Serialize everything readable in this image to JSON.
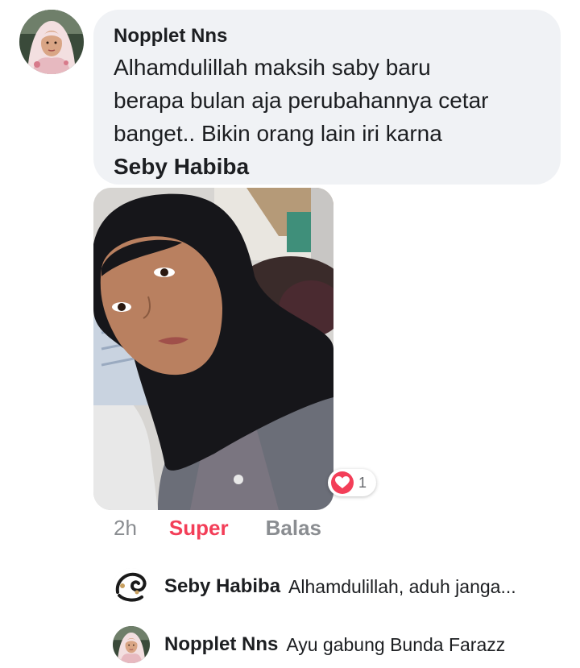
{
  "comment": {
    "author": "Nopplet Nns",
    "text_lines": [
      "Alhamdulillah maksih saby baru",
      "berapa bulan aja perubahannya cetar",
      "banget..  Bikin orang lain iri karna"
    ],
    "tag": "Seby Habiba",
    "avatar_icon": "profile-photo-icon",
    "photo_icon": "selfie-photo-icon"
  },
  "reaction": {
    "icon": "heart-icon",
    "count": "1",
    "color": "#f33e58"
  },
  "actions": {
    "time": "2h",
    "reaction_label": "Super",
    "reply_label": "Balas"
  },
  "replies": [
    {
      "name": "Seby Habiba",
      "text": "Alhamdulillah, aduh janga...",
      "avatar_icon": "logo-avatar-icon"
    },
    {
      "name": "Nopplet Nns",
      "text": "Ayu gabung Bunda Farazz",
      "avatar_icon": "profile-photo-icon"
    }
  ],
  "colors": {
    "bubble_bg": "#f0f2f5",
    "text": "#1c1e21",
    "muted": "#8a8d91",
    "accent": "#f33e58"
  }
}
